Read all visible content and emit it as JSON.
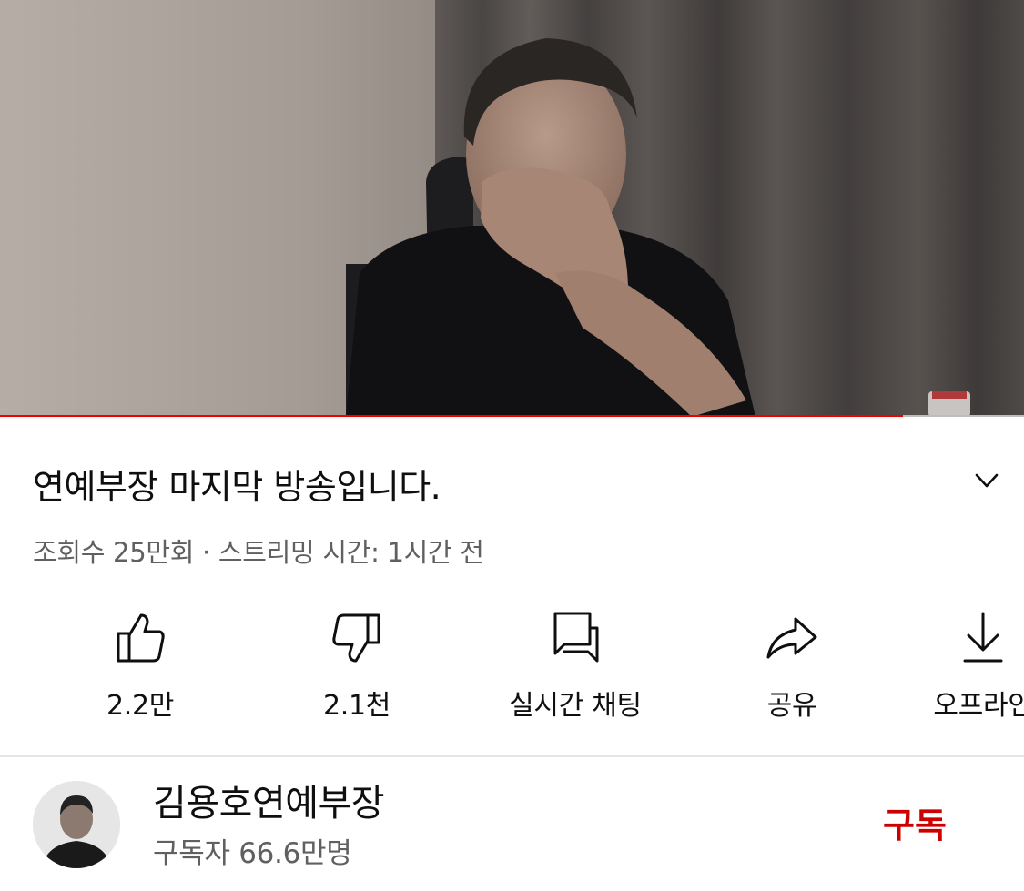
{
  "player": {
    "progress": 0.882
  },
  "video": {
    "title": "연예부장 마지막 방송입니다.",
    "meta": "조회수 25만회 · 스트리밍 시간: 1시간 전"
  },
  "actions": {
    "like": {
      "label": "2.2만",
      "icon": "thumbs-up-icon"
    },
    "dislike": {
      "label": "2.1천",
      "icon": "thumbs-down-icon"
    },
    "chat": {
      "label": "실시간 채팅",
      "icon": "live-chat-icon"
    },
    "share": {
      "label": "공유",
      "icon": "share-icon"
    },
    "offline": {
      "label": "오프라인",
      "icon": "download-icon"
    }
  },
  "channel": {
    "name": "김용호연예부장",
    "subscribers": "구독자 66.6만명",
    "subscribe_label": "구독"
  },
  "colors": {
    "accent": "#cc0000",
    "progress": "#f20000",
    "secondary_text": "#606060"
  }
}
